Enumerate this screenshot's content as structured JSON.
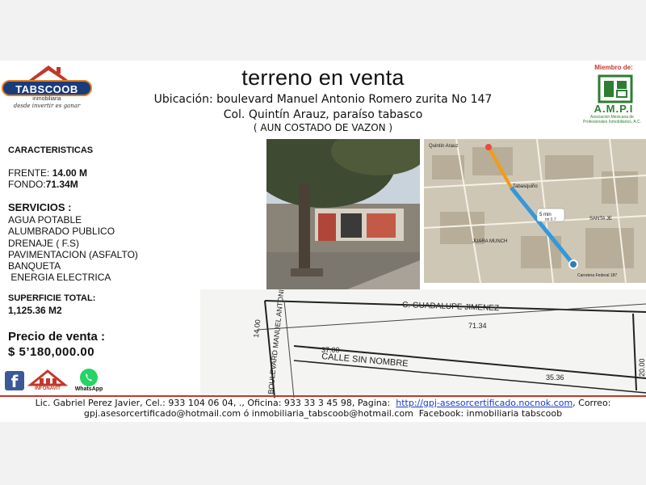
{
  "header": {
    "title": "terreno en venta",
    "location_line1": "Ubicación:  boulevard Manuel  Antonio Romero zurita No 147",
    "location_line2": "Col. Quintín Arauz, paraíso tabasco",
    "location_line3": "( AUN COSTADO DE VAZON )"
  },
  "logo": {
    "brand": "TABSCOOB",
    "sub": "inmobiliaria",
    "tagline": "desde invertir es ganar"
  },
  "ampi": {
    "miembro": "Miembro de:",
    "name": "A.M.P.I",
    "desc": "Asociación Mexicana de Profesionales Inmobiliarios, A.C."
  },
  "details": {
    "caracteristicas_title": "CARACTERISTICAS",
    "frente_label": "FRENTE:",
    "frente_value": "14.00 M",
    "fondo_label": "FONDO:",
    "fondo_value": "71.34M",
    "servicios_title": "SERVICIOS :",
    "servicios": [
      "AGUA POTABLE",
      "ALUMBRADO PUBLICO",
      "DRENAJE  ( F.S)",
      "PAVIMENTACION (ASFALTO)",
      "BANQUETA",
      " ENERGIA ELECTRICA"
    ],
    "superficie_label": "SUPERFICIE TOTAL:",
    "superficie_value": "1,125.36 M2",
    "precio_label": "Precio de venta  :",
    "precio_value": "$ 5’180,000.00"
  },
  "icons": {
    "infonavit": "INFONAVIT",
    "whatsapp": "WhatsApp",
    "facebook_glyph": "f"
  },
  "map": {
    "route_badge": "5 min",
    "route_distance": "mi 0.7",
    "place_top": "Quintín Arauz",
    "place_mid": "Tabasquiño",
    "street1": "SANTA JE",
    "street2": "JUARA MUNCH",
    "place_bottom": "Carretera Federal 187"
  },
  "plan": {
    "street_top": "C. GUADALUPE JIMENEZ",
    "street_side": "BOULEVARD MANUEL ANTONIO RO",
    "street_mid": "CALLE SIN NOMBRE",
    "dim_top": "71.34",
    "dim_left": "14.00",
    "dim_mid": "37.00",
    "dim_bottom": "35.36",
    "dim_right": "20.00"
  },
  "footer": {
    "line1_prefix": "Lic. Gabriel Perez Javier, Cel.: 933 104 06 04, ., Oficina: 933 33 3 45 98, Pagina:  ",
    "link": "http://gpj-asesorcertificado.nocnok.com",
    "line1_suffix": ", Correo:",
    "line2": "gpj.asesorcertificado@hotmail.com ó inmobiliaria_tabscoob@hotmail.com  Facebook: inmobiliaria tabscoob"
  },
  "colors": {
    "footer_rule": "#c0392b",
    "ampi_green": "#2e7d32",
    "link": "#1a3cc8"
  }
}
